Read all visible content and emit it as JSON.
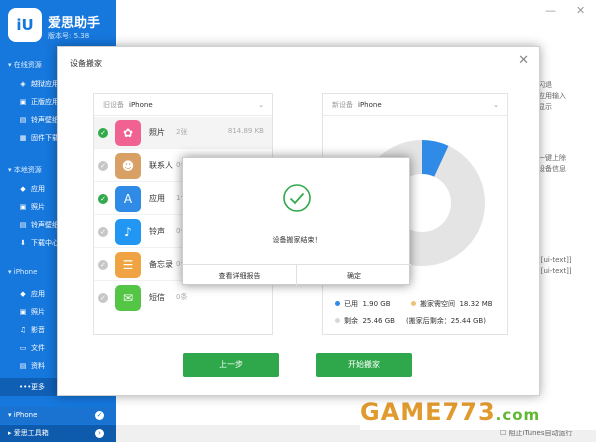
{
  "app": {
    "title": "爱思助手",
    "version": "版本号: 5.38",
    "logo": "iU"
  },
  "sidebar": {
    "sections": [
      {
        "label": "在线资源",
        "items": [
          "越狱应用",
          "正版应用",
          "铃声壁纸",
          "固件下载"
        ]
      },
      {
        "label": "本地资源",
        "items": [
          "应用",
          "照片",
          "铃声壁纸",
          "下载中心"
        ]
      },
      {
        "label": "iPhone",
        "items": [
          "应用",
          "照片",
          "影音",
          "文件",
          "资料",
          "更多"
        ]
      }
    ],
    "bottom": {
      "device": "iPhone",
      "toolbox": "爱思工具箱"
    }
  },
  "background_panel": {
    "lines": [
      "闪退",
      "应用输入",
      "显示",
      "一键上除",
      "设备信息",
      "[[ui-text]]",
      "[[ui-text]]"
    ]
  },
  "footer": {
    "note": "阻止iTunes自动运行"
  },
  "watermark": {
    "text": "GAME773",
    "suffix": ".com"
  },
  "modal": {
    "title": "设备搬家",
    "old_device": {
      "label": "旧设备",
      "name": "iPhone"
    },
    "new_device": {
      "label": "新设备",
      "name": "iPhone"
    },
    "rows": [
      {
        "label": "照片",
        "count": "2张",
        "size": "814.89 KB",
        "checked": true,
        "icon": "photos-icon",
        "color": "#f06292"
      },
      {
        "label": "联系人",
        "count": "0个",
        "size": "",
        "checked": false,
        "icon": "contacts-icon",
        "color": "#d9a066"
      },
      {
        "label": "应用",
        "count": "1个",
        "size": "",
        "checked": true,
        "icon": "appstore-icon",
        "color": "#2f8be6"
      },
      {
        "label": "铃声",
        "count": "0个",
        "size": "",
        "checked": false,
        "icon": "bell-icon",
        "color": "#2196f3"
      },
      {
        "label": "备忘录",
        "count": "0个",
        "size": "",
        "checked": false,
        "icon": "notes-icon",
        "color": "#f0a342"
      },
      {
        "label": "短信",
        "count": "0条",
        "size": "",
        "checked": false,
        "icon": "messages-icon",
        "color": "#55c546"
      }
    ],
    "storage": {
      "used_label": "已用",
      "used_value": "1.90 GB",
      "used_color": "#2f8be6",
      "needed_label": "搬家需空间",
      "needed_value": "18.32 MB",
      "needed_color": "#f0c27a",
      "free_label": "剩余",
      "free_value": "25.46 GB",
      "free_color": "#d7d7d7",
      "after_note": "(搬家后剩余：25.44 GB)",
      "used_fraction": 0.069
    },
    "buttons": {
      "prev": "上一步",
      "start": "开始搬家"
    }
  },
  "dialog": {
    "message": "设备搬家结束！",
    "report_button": "查看详细报告",
    "ok_button": "确定"
  },
  "window": {
    "minimize": "—",
    "close": "✕"
  }
}
